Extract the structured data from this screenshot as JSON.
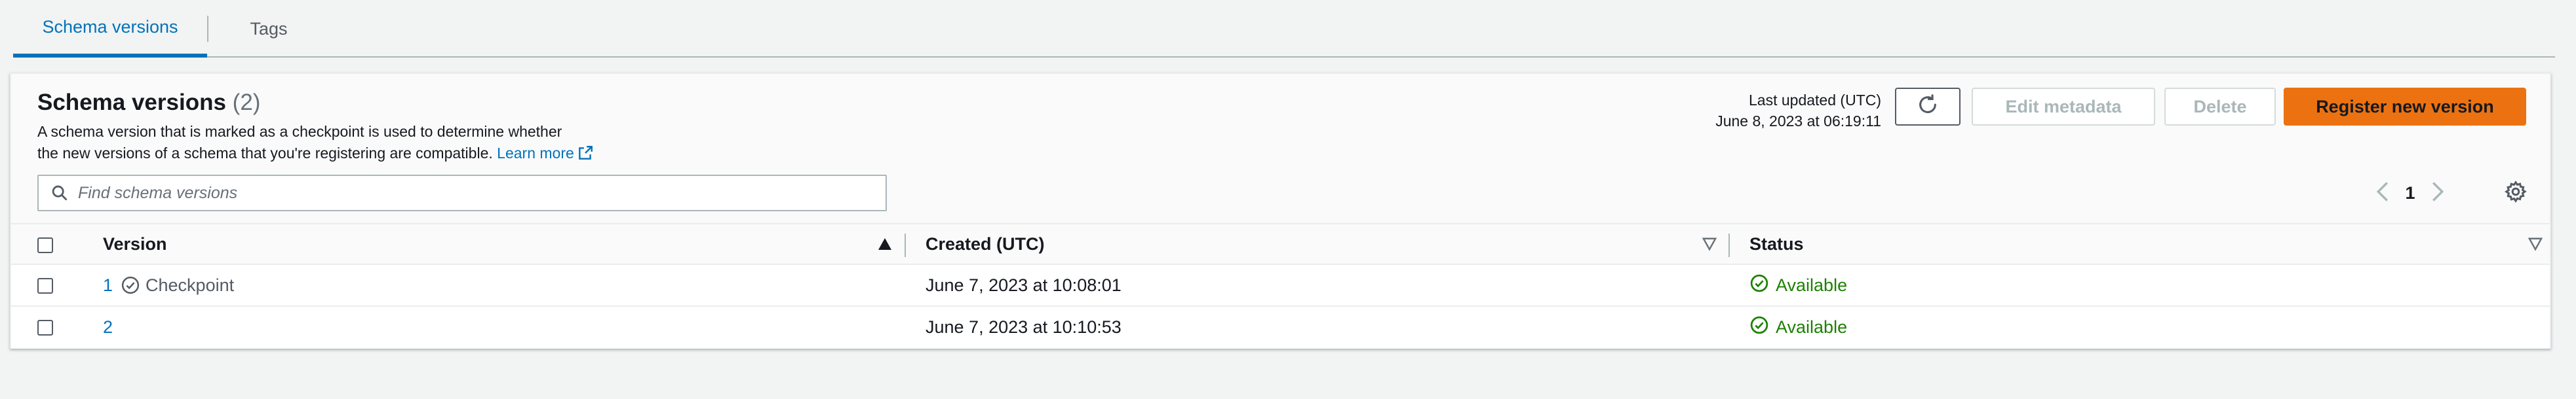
{
  "tabs": [
    {
      "label": "Schema versions",
      "active": true
    },
    {
      "label": "Tags",
      "active": false
    }
  ],
  "header": {
    "title": "Schema versions",
    "count": "(2)",
    "description_line1": "A schema version that is marked as a checkpoint is used to determine whether",
    "description_line2": "the new versions of a schema that you're registering are compatible.",
    "learn_more": "Learn more",
    "last_updated_label": "Last updated (UTC)",
    "last_updated_value": "June 8, 2023 at 06:19:11",
    "edit_metadata_label": "Edit metadata",
    "delete_label": "Delete",
    "register_label": "Register new version"
  },
  "search": {
    "placeholder": "Find schema versions",
    "value": ""
  },
  "pagination": {
    "current_page": "1"
  },
  "table": {
    "columns": [
      "Version",
      "Created (UTC)",
      "Status"
    ],
    "rows": [
      {
        "version": "1",
        "checkpoint": "Checkpoint",
        "created": "June 7, 2023 at 10:08:01",
        "status": "Available"
      },
      {
        "version": "2",
        "checkpoint": "",
        "created": "June 7, 2023 at 10:10:53",
        "status": "Available"
      }
    ]
  },
  "colors": {
    "accent": "#0073bb",
    "primary_button": "#ec7211",
    "success": "#1d8102"
  },
  "icons": [
    "refresh-icon",
    "search-icon",
    "chevron-left-icon",
    "chevron-right-icon",
    "gear-icon",
    "external-link-icon",
    "check-circle-icon",
    "sort-ascending-icon",
    "sort-icon"
  ]
}
